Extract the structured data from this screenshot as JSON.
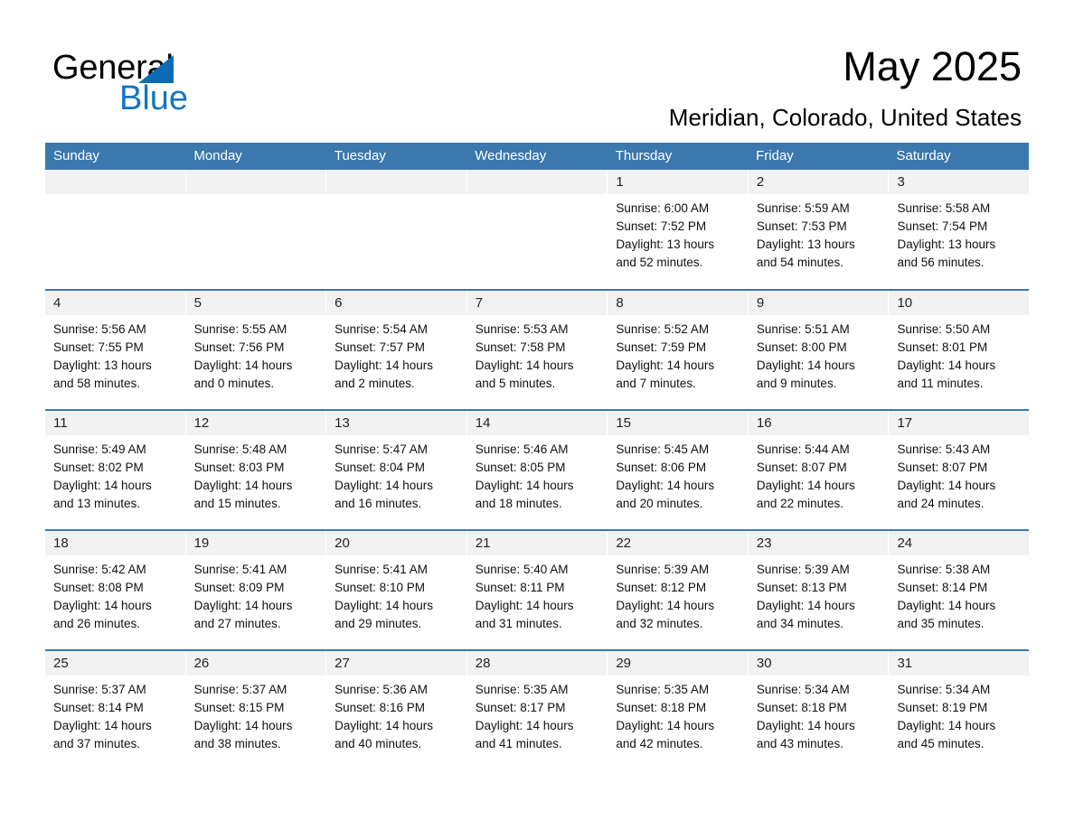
{
  "brand": {
    "name_part1": "General",
    "name_part2": "Blue",
    "triangle_icon": "triangle-icon",
    "accent_color": "#1276c4"
  },
  "header": {
    "month_title": "May 2025",
    "location": "Meridian, Colorado, United States"
  },
  "theme": {
    "header_bar_color": "#3b78ad",
    "day_band_color": "#f2f2f2",
    "row_divider_color": "#3b78ad"
  },
  "weekdays": [
    "Sunday",
    "Monday",
    "Tuesday",
    "Wednesday",
    "Thursday",
    "Friday",
    "Saturday"
  ],
  "weeks": [
    [
      {
        "empty": true
      },
      {
        "empty": true
      },
      {
        "empty": true
      },
      {
        "empty": true
      },
      {
        "day": "1",
        "sunrise": "Sunrise: 6:00 AM",
        "sunset": "Sunset: 7:52 PM",
        "daylight_line1": "Daylight: 13 hours",
        "daylight_line2": "and 52 minutes."
      },
      {
        "day": "2",
        "sunrise": "Sunrise: 5:59 AM",
        "sunset": "Sunset: 7:53 PM",
        "daylight_line1": "Daylight: 13 hours",
        "daylight_line2": "and 54 minutes."
      },
      {
        "day": "3",
        "sunrise": "Sunrise: 5:58 AM",
        "sunset": "Sunset: 7:54 PM",
        "daylight_line1": "Daylight: 13 hours",
        "daylight_line2": "and 56 minutes."
      }
    ],
    [
      {
        "day": "4",
        "sunrise": "Sunrise: 5:56 AM",
        "sunset": "Sunset: 7:55 PM",
        "daylight_line1": "Daylight: 13 hours",
        "daylight_line2": "and 58 minutes."
      },
      {
        "day": "5",
        "sunrise": "Sunrise: 5:55 AM",
        "sunset": "Sunset: 7:56 PM",
        "daylight_line1": "Daylight: 14 hours",
        "daylight_line2": "and 0 minutes."
      },
      {
        "day": "6",
        "sunrise": "Sunrise: 5:54 AM",
        "sunset": "Sunset: 7:57 PM",
        "daylight_line1": "Daylight: 14 hours",
        "daylight_line2": "and 2 minutes."
      },
      {
        "day": "7",
        "sunrise": "Sunrise: 5:53 AM",
        "sunset": "Sunset: 7:58 PM",
        "daylight_line1": "Daylight: 14 hours",
        "daylight_line2": "and 5 minutes."
      },
      {
        "day": "8",
        "sunrise": "Sunrise: 5:52 AM",
        "sunset": "Sunset: 7:59 PM",
        "daylight_line1": "Daylight: 14 hours",
        "daylight_line2": "and 7 minutes."
      },
      {
        "day": "9",
        "sunrise": "Sunrise: 5:51 AM",
        "sunset": "Sunset: 8:00 PM",
        "daylight_line1": "Daylight: 14 hours",
        "daylight_line2": "and 9 minutes."
      },
      {
        "day": "10",
        "sunrise": "Sunrise: 5:50 AM",
        "sunset": "Sunset: 8:01 PM",
        "daylight_line1": "Daylight: 14 hours",
        "daylight_line2": "and 11 minutes."
      }
    ],
    [
      {
        "day": "11",
        "sunrise": "Sunrise: 5:49 AM",
        "sunset": "Sunset: 8:02 PM",
        "daylight_line1": "Daylight: 14 hours",
        "daylight_line2": "and 13 minutes."
      },
      {
        "day": "12",
        "sunrise": "Sunrise: 5:48 AM",
        "sunset": "Sunset: 8:03 PM",
        "daylight_line1": "Daylight: 14 hours",
        "daylight_line2": "and 15 minutes."
      },
      {
        "day": "13",
        "sunrise": "Sunrise: 5:47 AM",
        "sunset": "Sunset: 8:04 PM",
        "daylight_line1": "Daylight: 14 hours",
        "daylight_line2": "and 16 minutes."
      },
      {
        "day": "14",
        "sunrise": "Sunrise: 5:46 AM",
        "sunset": "Sunset: 8:05 PM",
        "daylight_line1": "Daylight: 14 hours",
        "daylight_line2": "and 18 minutes."
      },
      {
        "day": "15",
        "sunrise": "Sunrise: 5:45 AM",
        "sunset": "Sunset: 8:06 PM",
        "daylight_line1": "Daylight: 14 hours",
        "daylight_line2": "and 20 minutes."
      },
      {
        "day": "16",
        "sunrise": "Sunrise: 5:44 AM",
        "sunset": "Sunset: 8:07 PM",
        "daylight_line1": "Daylight: 14 hours",
        "daylight_line2": "and 22 minutes."
      },
      {
        "day": "17",
        "sunrise": "Sunrise: 5:43 AM",
        "sunset": "Sunset: 8:07 PM",
        "daylight_line1": "Daylight: 14 hours",
        "daylight_line2": "and 24 minutes."
      }
    ],
    [
      {
        "day": "18",
        "sunrise": "Sunrise: 5:42 AM",
        "sunset": "Sunset: 8:08 PM",
        "daylight_line1": "Daylight: 14 hours",
        "daylight_line2": "and 26 minutes."
      },
      {
        "day": "19",
        "sunrise": "Sunrise: 5:41 AM",
        "sunset": "Sunset: 8:09 PM",
        "daylight_line1": "Daylight: 14 hours",
        "daylight_line2": "and 27 minutes."
      },
      {
        "day": "20",
        "sunrise": "Sunrise: 5:41 AM",
        "sunset": "Sunset: 8:10 PM",
        "daylight_line1": "Daylight: 14 hours",
        "daylight_line2": "and 29 minutes."
      },
      {
        "day": "21",
        "sunrise": "Sunrise: 5:40 AM",
        "sunset": "Sunset: 8:11 PM",
        "daylight_line1": "Daylight: 14 hours",
        "daylight_line2": "and 31 minutes."
      },
      {
        "day": "22",
        "sunrise": "Sunrise: 5:39 AM",
        "sunset": "Sunset: 8:12 PM",
        "daylight_line1": "Daylight: 14 hours",
        "daylight_line2": "and 32 minutes."
      },
      {
        "day": "23",
        "sunrise": "Sunrise: 5:39 AM",
        "sunset": "Sunset: 8:13 PM",
        "daylight_line1": "Daylight: 14 hours",
        "daylight_line2": "and 34 minutes."
      },
      {
        "day": "24",
        "sunrise": "Sunrise: 5:38 AM",
        "sunset": "Sunset: 8:14 PM",
        "daylight_line1": "Daylight: 14 hours",
        "daylight_line2": "and 35 minutes."
      }
    ],
    [
      {
        "day": "25",
        "sunrise": "Sunrise: 5:37 AM",
        "sunset": "Sunset: 8:14 PM",
        "daylight_line1": "Daylight: 14 hours",
        "daylight_line2": "and 37 minutes."
      },
      {
        "day": "26",
        "sunrise": "Sunrise: 5:37 AM",
        "sunset": "Sunset: 8:15 PM",
        "daylight_line1": "Daylight: 14 hours",
        "daylight_line2": "and 38 minutes."
      },
      {
        "day": "27",
        "sunrise": "Sunrise: 5:36 AM",
        "sunset": "Sunset: 8:16 PM",
        "daylight_line1": "Daylight: 14 hours",
        "daylight_line2": "and 40 minutes."
      },
      {
        "day": "28",
        "sunrise": "Sunrise: 5:35 AM",
        "sunset": "Sunset: 8:17 PM",
        "daylight_line1": "Daylight: 14 hours",
        "daylight_line2": "and 41 minutes."
      },
      {
        "day": "29",
        "sunrise": "Sunrise: 5:35 AM",
        "sunset": "Sunset: 8:18 PM",
        "daylight_line1": "Daylight: 14 hours",
        "daylight_line2": "and 42 minutes."
      },
      {
        "day": "30",
        "sunrise": "Sunrise: 5:34 AM",
        "sunset": "Sunset: 8:18 PM",
        "daylight_line1": "Daylight: 14 hours",
        "daylight_line2": "and 43 minutes."
      },
      {
        "day": "31",
        "sunrise": "Sunrise: 5:34 AM",
        "sunset": "Sunset: 8:19 PM",
        "daylight_line1": "Daylight: 14 hours",
        "daylight_line2": "and 45 minutes."
      }
    ]
  ]
}
